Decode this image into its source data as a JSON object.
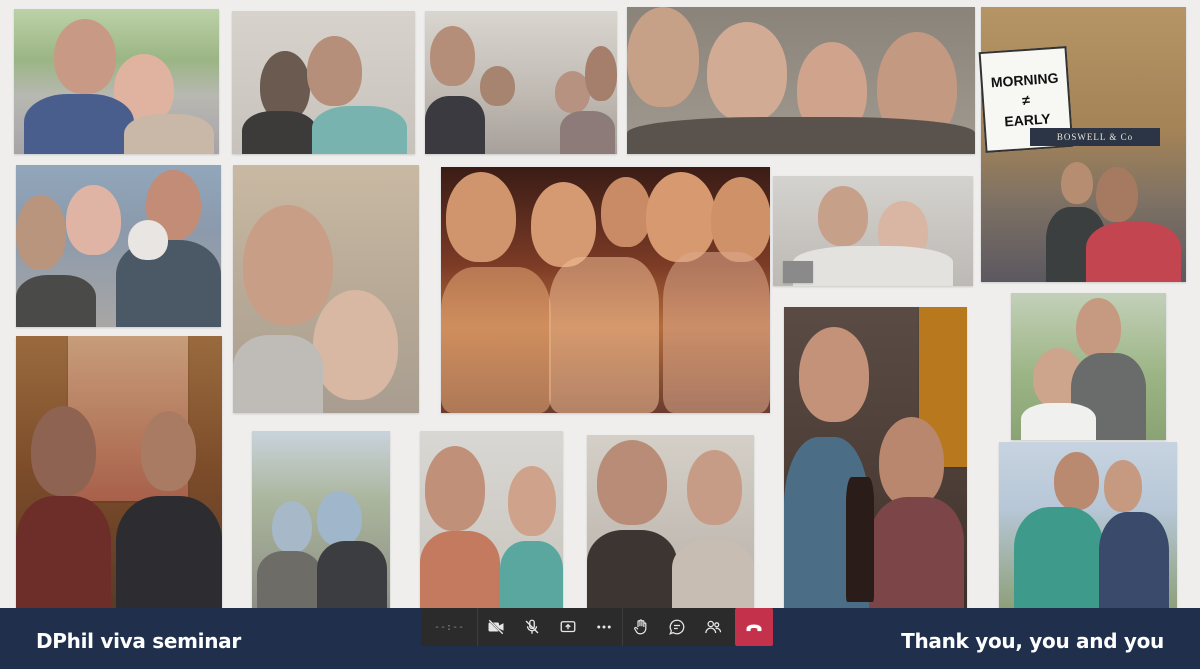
{
  "meeting": {
    "title": "DPhil viva seminar",
    "slide_caption": "Thank you, you and you",
    "timer_text": "--:--"
  },
  "slide": {
    "sign_line1": "MORNING",
    "sign_line2": "≠",
    "sign_line3": "EARLY",
    "storefront_text": "BOSWELL & Co"
  },
  "controls": {
    "camera_icon": "camera-off-icon",
    "mic_icon": "mic-off-icon",
    "share_icon": "share-screen-icon",
    "more_icon": "more-options-icon",
    "raise_hand_icon": "raise-hand-icon",
    "chat_icon": "chat-icon",
    "participants_icon": "participants-icon",
    "hangup_icon": "hang-up-icon"
  },
  "colors": {
    "bottom_bar": "#1f2f4c",
    "controls_bg": "#2b2b2b",
    "hangup": "#c4314b",
    "slide_bg": "#efeeed"
  }
}
